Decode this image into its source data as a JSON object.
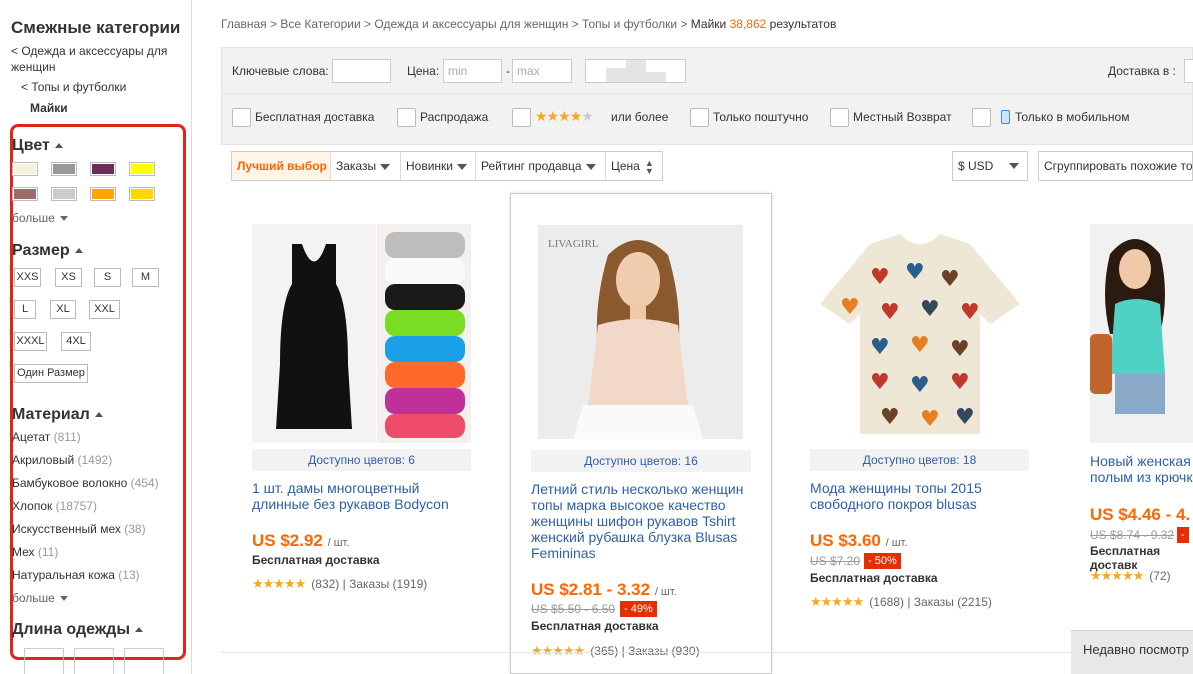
{
  "sidebar": {
    "title": "Смежные категории",
    "cat1": "< Одежда и аксессуары для женщин",
    "cat2": "< Топы и футболки",
    "cat3": "Майки",
    "color_title": "Цвет",
    "colors": [
      "#f8f2dc",
      "#999999",
      "#6b2d5c",
      "#ffff00",
      "#9e6b6b",
      "#cccccc",
      "#ffa500",
      "#ffd700"
    ],
    "more": "больше",
    "size_title": "Размер",
    "sizes": [
      "XXS",
      "XS",
      "S",
      "M",
      "L",
      "XL",
      "XXL",
      "XXXL",
      "4XL",
      "Один Размер"
    ],
    "material_title": "Материал",
    "materials": [
      {
        "name": "Ацетат",
        "count": "(811)"
      },
      {
        "name": "Акриловый",
        "count": "(1492)"
      },
      {
        "name": "Бамбуковое волокно",
        "count": "(454)"
      },
      {
        "name": "Хлопок",
        "count": "(18757)"
      },
      {
        "name": "Искусственный мех",
        "count": "(38)"
      },
      {
        "name": "Мех",
        "count": "(11)"
      },
      {
        "name": "Натуральная кожа",
        "count": "(13)"
      }
    ],
    "more2": "больше",
    "length_title": "Длина одежды"
  },
  "breadcrumb": {
    "home": "Главная",
    "all": "Все Категории",
    "women": "Одежда и аксессуары для женщин",
    "tops": "Топы и футболки",
    "current": "Майки",
    "count": "38,862",
    "results": "результатов"
  },
  "filters": {
    "keywords": "Ключевые слова:",
    "price": "Цена:",
    "min": "min",
    "max": "max",
    "dash": "-",
    "delivery": "Доставка в :",
    "free_shipping": "Бесплатная доставка",
    "sale": "Распродажа",
    "or_more": "или более",
    "piece": "Только поштучно",
    "local_return": "Местный Возврат",
    "mobile": "Только в мобильном"
  },
  "sort": {
    "best": "Лучший выбор",
    "orders": "Заказы",
    "new": "Новинки",
    "seller": "Рейтинг продавца",
    "price": "Цена",
    "currency": "$ USD",
    "group": "Сгруппировать похожие то"
  },
  "products": [
    {
      "avail": "Доступно цветов: 6",
      "title": "1 шт. дамы многоцветный длинные без рукавов Bodycon",
      "price": "US $2.92",
      "unit": "/ шт.",
      "free": "Бесплатная доставка",
      "reviews": "(832)",
      "orders": "Заказы (1919)"
    },
    {
      "avail": "Доступно цветов: 16",
      "title": "Летний стиль несколько женщин топы марка высокое качество женщины шифон рукавов Tshirt женский рубашка блузка Blusas Femininas",
      "price": "US $2.81 - 3.32",
      "unit": "/ шт.",
      "old": "US $5.50 - 6.50",
      "disc": "- 49%",
      "free": "Бесплатная доставка",
      "reviews": "(365)",
      "orders": "Заказы (930)",
      "brand": "LIVAGIRL"
    },
    {
      "avail": "Доступно цветов: 18",
      "title": "Мода женщины топы 2015 свободного покроя blusas",
      "price": "US $3.60",
      "unit": "/ шт.",
      "old": "US $7.20",
      "disc": "- 50%",
      "free": "Бесплатная доставка",
      "reviews": "(1688)",
      "orders": "Заказы (2215)"
    },
    {
      "title": "Новый женская полым из крючк",
      "price": "US $4.46 - 4.",
      "old": "US $8.74 - 9.32",
      "disc": "-",
      "free": "Бесплатная доставк",
      "reviews": "(72)"
    }
  ],
  "recent": "Недавно посмотр",
  "rating_sep": "|",
  "star_chars": "★★★★★"
}
